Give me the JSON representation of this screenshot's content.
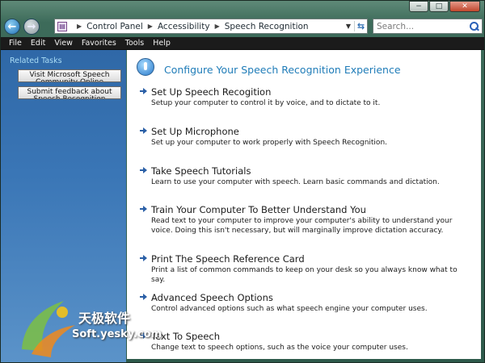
{
  "window": {
    "caption_minimize": "−",
    "caption_maximize": "□",
    "caption_close": "✕"
  },
  "nav": {
    "back_glyph": "←",
    "forward_glyph": "→",
    "breadcrumbs": [
      "Control Panel",
      "Accessibility",
      "Speech Recognition"
    ],
    "search_placeholder": "Search..."
  },
  "menu": [
    "File",
    "Edit",
    "View",
    "Favorites",
    "Tools",
    "Help"
  ],
  "sidebar": {
    "title": "Related Tasks",
    "tasks": [
      "Visit Microsoft Speech Community Online",
      "Submit feedback about Speech Recognition"
    ]
  },
  "main": {
    "title": "Configure Your Speech Recognition Experience",
    "tasks": [
      {
        "title": "Set Up Speech Recogition",
        "desc": "Setup your computer to control it by voice, and to dictate to it."
      },
      {
        "title": "Set Up Microphone",
        "desc": "Set up your computer to work properly with Speech Recognition."
      },
      {
        "title": "Take Speech Tutorials",
        "desc": "Learn to use your computer with speech.  Learn basic commands and dictation."
      },
      {
        "title": "Train Your Computer To Better Understand You",
        "desc": "Read text to your computer to improve your computer's ability to understand your voice.  Doing this isn't necessary, but will marginally improve dictation accuracy."
      },
      {
        "title": "Print The Speech Reference Card",
        "desc": "Print a list of common commands to keep on your desk so you always know what to say."
      },
      {
        "title": "Advanced Speech Options",
        "desc": "Control advanced options such as what speech engine your computer uses."
      },
      {
        "title": "Text To Speech",
        "desc": "Change text to speech options, such as the voice your computer uses."
      }
    ]
  },
  "watermark": {
    "name": "天极软件",
    "url": "Soft.yesky.com"
  }
}
